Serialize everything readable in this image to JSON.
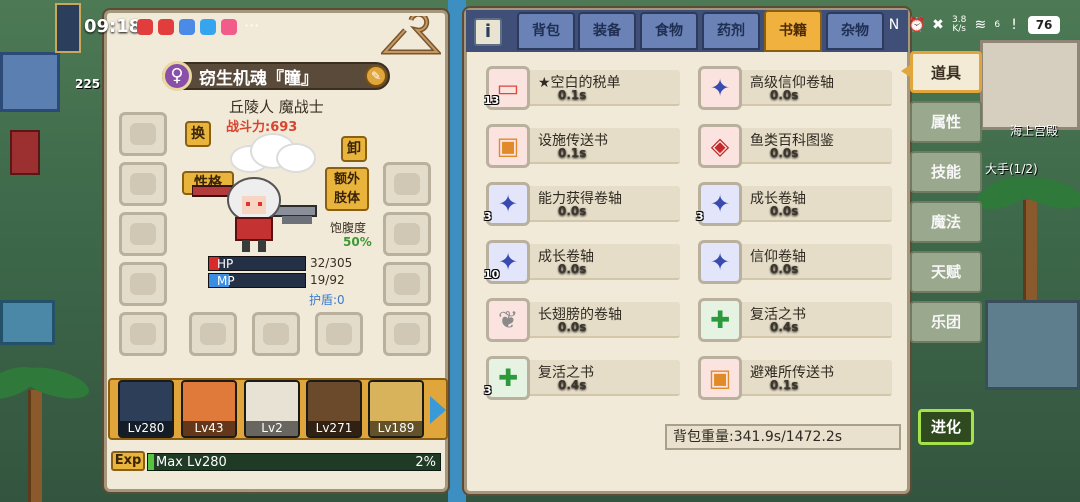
{
  "status_bar": {
    "time": "09:18",
    "network_speed_value": "3.8",
    "network_speed_unit": "K/s",
    "signal_label": "6",
    "battery": "76",
    "overflow": "···"
  },
  "left_strip": {
    "count": "225"
  },
  "character": {
    "gender_icon": "♀",
    "name": "窃生机魂『瞳』",
    "race_class": "丘陵人 魔战士",
    "combat_power": "战斗力:693",
    "swap_button": "换",
    "unequip_button": "卸",
    "personality_button": "性格",
    "extra_limb_button_line1": "额外",
    "extra_limb_button_line2": "肢体",
    "satiety_label": "饱腹度",
    "satiety_value": "50%",
    "hp_label": "HP",
    "hp_value": "32/305",
    "hp_fraction": 0.105,
    "mp_label": "MP",
    "mp_value": "19/92",
    "mp_fraction": 0.207,
    "shield_text": "护盾:0"
  },
  "party": {
    "members": [
      {
        "level": "Lv280"
      },
      {
        "level": "Lv43"
      },
      {
        "level": "Lv2"
      },
      {
        "level": "Lv271"
      },
      {
        "level": "Lv189"
      }
    ]
  },
  "exp": {
    "badge": "Exp",
    "label": "Max Lv280",
    "percent": "2%",
    "fraction": 0.02
  },
  "inventory": {
    "tabs": [
      "背包",
      "装备",
      "食物",
      "药剂",
      "书籍",
      "杂物"
    ],
    "active_tab": "书籍",
    "items": [
      {
        "name": "★空白的税单",
        "time": "0.1s",
        "qty": "13"
      },
      {
        "name": "高级信仰卷轴",
        "time": "0.0s",
        "qty": ""
      },
      {
        "name": "设施传送书",
        "time": "0.1s",
        "qty": ""
      },
      {
        "name": "鱼类百科图鉴",
        "time": "0.0s",
        "qty": ""
      },
      {
        "name": "能力获得卷轴",
        "time": "0.0s",
        "qty": "3"
      },
      {
        "name": "成长卷轴",
        "time": "0.0s",
        "qty": "3"
      },
      {
        "name": "成长卷轴",
        "time": "0.0s",
        "qty": "10"
      },
      {
        "name": "信仰卷轴",
        "time": "0.0s",
        "qty": ""
      },
      {
        "name": "长翅膀的卷轴",
        "time": "0.0s",
        "qty": ""
      },
      {
        "name": "复活之书",
        "time": "0.4s",
        "qty": ""
      },
      {
        "name": "复活之书",
        "time": "0.4s",
        "qty": "3"
      },
      {
        "name": "避难所传送书",
        "time": "0.1s",
        "qty": ""
      }
    ],
    "weight": "背包重量:341.9s/1472.2s"
  },
  "side_tabs": [
    {
      "label": "道具",
      "active": true
    },
    {
      "label": "属性",
      "active": false
    },
    {
      "label": "技能",
      "active": false
    },
    {
      "label": "魔法",
      "active": false
    },
    {
      "label": "天赋",
      "active": false
    },
    {
      "label": "乐团",
      "active": false
    }
  ],
  "evolve_button": "进化",
  "world_labels": {
    "place": "海上宫殿",
    "quest": "大手(1/2)"
  }
}
